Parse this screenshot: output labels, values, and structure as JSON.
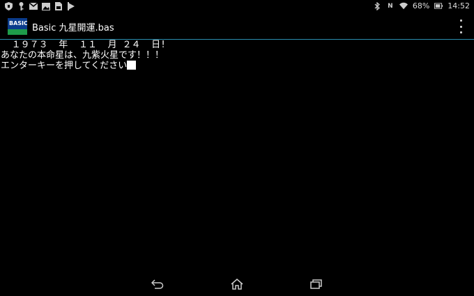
{
  "status_bar": {
    "left_icons": [
      "shield-icon",
      "key-icon",
      "mail-icon",
      "image-icon",
      "sim-icon",
      "download-icon"
    ],
    "right_icons": [
      "bluetooth-icon",
      "nfc-icon",
      "wifi-icon"
    ],
    "nfc_label": "N",
    "battery_percent": "68%",
    "time": "14:52"
  },
  "action_bar": {
    "app_icon_text": "BASIC",
    "title": "Basic  九星開運.bas"
  },
  "console": {
    "lines": [
      "  １９７３  年  １１  月 ２４  日!",
      "あなたの本命星は、九紫火星です！！！",
      "エンターキーを押してください"
    ]
  },
  "nav_bar": {
    "buttons": [
      "back-icon",
      "home-icon",
      "recent-apps-icon"
    ]
  },
  "colors": {
    "background": "#000000",
    "text": "#ffffff",
    "divider": "#2a8fb0"
  }
}
